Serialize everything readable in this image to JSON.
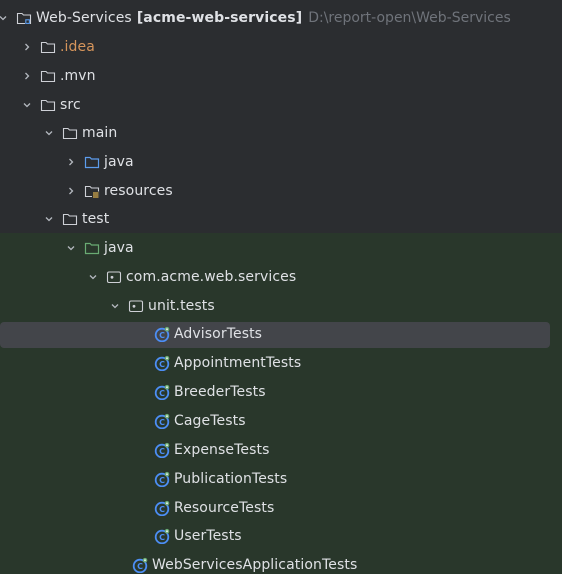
{
  "project": {
    "name": "Web-Services",
    "module": "[acme-web-services]",
    "path": "D:\\report-open\\Web-Services"
  },
  "tree": {
    "idea": ".idea",
    "mvn": ".mvn",
    "src": "src",
    "main": "main",
    "main_java": "java",
    "resources": "resources",
    "test": "test",
    "test_java": "java",
    "package": "com.acme.web.services",
    "unit_tests": "unit.tests",
    "tests": [
      "AdvisorTests",
      "AppointmentTests",
      "BreederTests",
      "CageTests",
      "ExpenseTests",
      "PublicationTests",
      "ResourceTests",
      "UserTests"
    ],
    "app_tests": "WebServicesApplicationTests"
  },
  "colors": {
    "background": "#2b2d30",
    "test_background": "#29372b",
    "selection": "#43454a",
    "excluded_orange": "#d6955b",
    "source_blue": "#5c9ded",
    "test_green": "#6aab73",
    "class_blue": "#4c8ef5",
    "text": "#dfe1e5",
    "path_grey": "#6f737a"
  },
  "icons": {
    "chevron_collapsed": "chevron-right-icon",
    "chevron_expanded": "chevron-down-icon",
    "folder": "folder-icon",
    "module": "module-folder-icon",
    "package": "package-icon",
    "resources": "resources-folder-icon",
    "test_class": "test-class-icon"
  },
  "selected_item": "AdvisorTests"
}
